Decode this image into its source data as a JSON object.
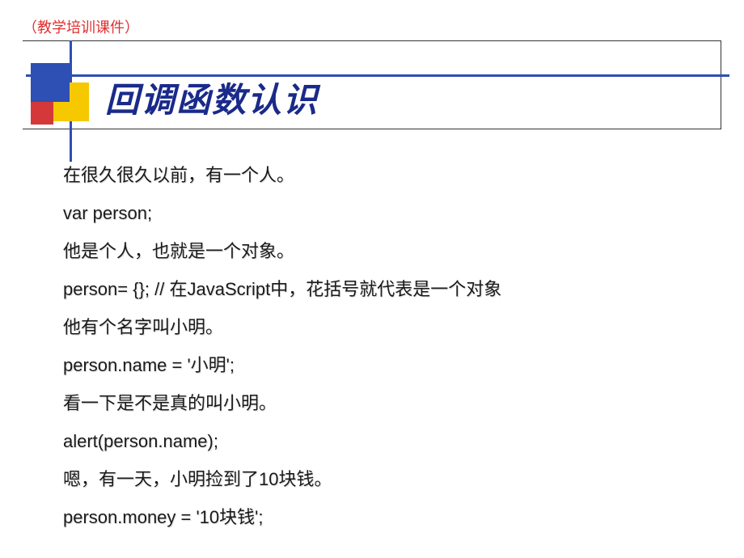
{
  "header": {
    "label": "（教学培训课件）"
  },
  "title": "回调函数认识",
  "content": {
    "lines": [
      "在很久很久以前，有一个人。",
      "var person;",
      "他是个人，也就是一个对象。",
      "person= {}; // 在JavaScript中，花括号就代表是一个对象",
      "他有个名字叫小明。",
      "person.name = '小明';",
      "看一下是不是真的叫小明。",
      "alert(person.name);",
      "嗯，有一天，小明捡到了10块钱。",
      "person.money = '10块钱';"
    ]
  }
}
